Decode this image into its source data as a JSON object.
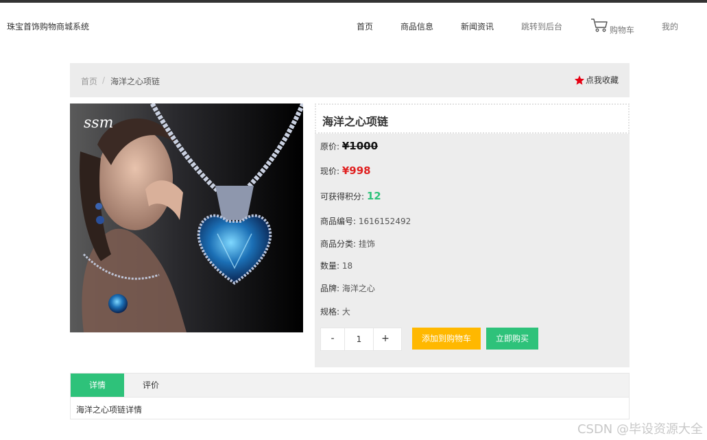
{
  "header": {
    "brand": "珠宝首饰购物商城系统",
    "nav": {
      "home": "首页",
      "products": "商品信息",
      "news": "新闻资讯",
      "admin": "跳转到后台",
      "cart": "购物车",
      "mine": "我的"
    }
  },
  "breadcrumb": {
    "home": "首页",
    "separator": "/",
    "current": "海洋之心项链",
    "favorite": "点我收藏"
  },
  "product": {
    "image_logo": "ssm",
    "title": "海洋之心项链",
    "original_price_label": "原价:",
    "original_price": "¥1000",
    "current_price_label": "现价:",
    "current_price": "¥998",
    "points_label": "可获得积分:",
    "points": "12",
    "sku_label": "商品编号:",
    "sku": "1616152492",
    "category_label": "商品分类:",
    "category": "挂饰",
    "stock_label": "数量:",
    "stock": "18",
    "brand_label": "品牌:",
    "brand": "海洋之心",
    "spec_label": "规格:",
    "spec": "大"
  },
  "purchase": {
    "minus": "-",
    "quantity": "1",
    "plus": "+",
    "add_to_cart": "添加到购物车",
    "buy_now": "立即购买"
  },
  "tabs": {
    "detail": "详情",
    "review": "评价",
    "content": "海洋之心项链详情"
  },
  "watermark": "CSDN @毕设资源大全",
  "colors": {
    "accent_green": "#2ec27a",
    "price_red": "#e02020",
    "cart_yellow": "#ffb800",
    "favorite_star": "#e60012"
  }
}
